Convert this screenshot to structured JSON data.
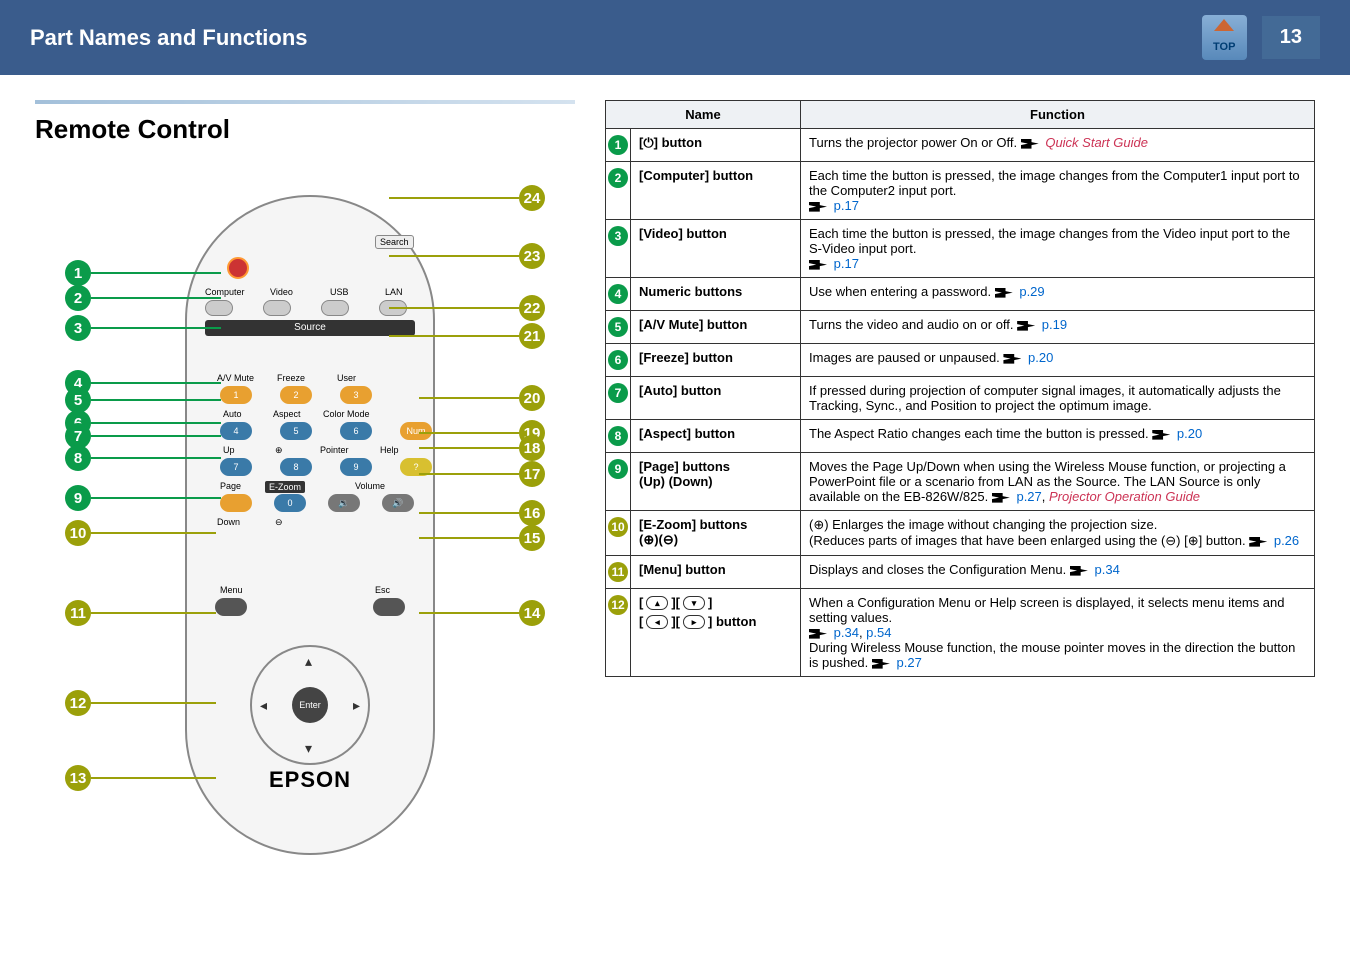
{
  "header": {
    "title": "Part Names and Functions",
    "top_label": "TOP",
    "page_num": "13"
  },
  "section": {
    "title": "Remote  Control"
  },
  "remote": {
    "source_bar": "Source",
    "labels": {
      "search": "Search",
      "computer": "Computer",
      "video": "Video",
      "usb": "USB",
      "lan": "LAN",
      "avmute": "A/V Mute",
      "freeze": "Freeze",
      "user": "User",
      "auto": "Auto",
      "aspect": "Aspect",
      "colormode": "Color Mode",
      "num": "Num",
      "up": "Up",
      "pointer": "Pointer",
      "help": "Help",
      "page": "Page",
      "ezoom": "E-Zoom",
      "volume": "Volume",
      "down": "Down",
      "menu": "Menu",
      "esc": "Esc",
      "enter": "Enter"
    },
    "logo": "EPSON"
  },
  "callouts_left": [
    "1",
    "2",
    "3",
    "4",
    "5",
    "6",
    "7",
    "8",
    "9",
    "10",
    "11",
    "12",
    "13"
  ],
  "callouts_right": [
    "24",
    "23",
    "22",
    "21",
    "20",
    "19",
    "18",
    "17",
    "16",
    "15",
    "14"
  ],
  "table": {
    "head": {
      "name": "Name",
      "function": "Function"
    },
    "rows": [
      {
        "num": "1",
        "color": "green",
        "name_html": "[<span style=\"font-family:sans-serif\">⏻</span>] button",
        "func": "Turns the projector power On or Off. <span class=\"ptr\"></span> <span class=\"italic\">Quick Start Guide</span>"
      },
      {
        "num": "2",
        "color": "green",
        "name_html": "[Computer] button",
        "func": "Each time the button is pressed, the image changes from the Computer1 input port to the Computer2 input port.<br><span class=\"ptr\"></span> <span class=\"link\">p.17</span>"
      },
      {
        "num": "3",
        "color": "green",
        "name_html": "[Video] button",
        "func": "Each time the button is pressed, the image changes from the Video input port to the S-Video input port.<br><span class=\"ptr\"></span> <span class=\"link\">p.17</span>"
      },
      {
        "num": "4",
        "color": "green",
        "name_html": "Numeric buttons",
        "func": "Use when entering a password. <span class=\"ptr\"></span> <span class=\"link\">p.29</span>"
      },
      {
        "num": "5",
        "color": "green",
        "name_html": "[A/V Mute] button",
        "func": "Turns the video and audio on or off. <span class=\"ptr\"></span> <span class=\"link\">p.19</span>"
      },
      {
        "num": "6",
        "color": "green",
        "name_html": "[Freeze] button",
        "func": "Images are paused or unpaused. <span class=\"ptr\"></span> <span class=\"link\">p.20</span>"
      },
      {
        "num": "7",
        "color": "green",
        "name_html": "[Auto] button",
        "func": "If pressed during projection of computer signal images, it automatically adjusts the Tracking, Sync., and Position to project the optimum image."
      },
      {
        "num": "8",
        "color": "green",
        "name_html": "[Aspect] button",
        "func": "The Aspect Ratio changes each time the button is pressed. <span class=\"ptr\"></span> <span class=\"link\">p.20</span>"
      },
      {
        "num": "9",
        "color": "green",
        "name_html": "[Page] buttons<br><span class=\"sub\">(Up) (Down)</span>",
        "func": "Moves the Page Up/Down when using the Wireless Mouse function, or projecting a PowerPoint file or a scenario from LAN as the Source. The LAN Source is only available on the EB-826W/825. <span class=\"ptr\"></span> <span class=\"link\">p.27</span>, <span class=\"italic\">Projector Operation Guide</span>"
      },
      {
        "num": "10",
        "color": "olive",
        "name_html": "[E-Zoom] buttons<br><span class=\"sub\">(⊕)(⊖)</span>",
        "func": "(⊕) Enlarges the image without changing the projection size.<br>(Reduces parts of images that have been enlarged using the (⊖) [⊕] button. <span class=\"ptr\"></span> <span class=\"link\">p.26</span>"
      },
      {
        "num": "11",
        "color": "olive",
        "name_html": "[Menu] button",
        "func": "Displays and closes the Configuration Menu. <span class=\"ptr\"></span> <span class=\"link\">p.34</span>"
      },
      {
        "num": "12",
        "color": "olive",
        "name_html": "<div class=\"dir-btn-row\">[<span class=\"dir-btn\">▴</span>][<span class=\"dir-btn\">▾</span>]</div><div class=\"dir-btn-row\" style=\"margin-top:4px\">[<span class=\"dir-btn\">◂</span>][<span class=\"dir-btn\">▸</span>] button</div>",
        "func": "When a Configuration Menu or Help screen is displayed, it selects menu items and setting values.<br><span class=\"ptr\"></span> <span class=\"link\">p.34</span>, <span class=\"link\">p.54</span><br>During Wireless Mouse function, the mouse pointer moves in the direction the button is pushed. <span class=\"ptr\"></span> <span class=\"link\">p.27</span>"
      }
    ]
  }
}
